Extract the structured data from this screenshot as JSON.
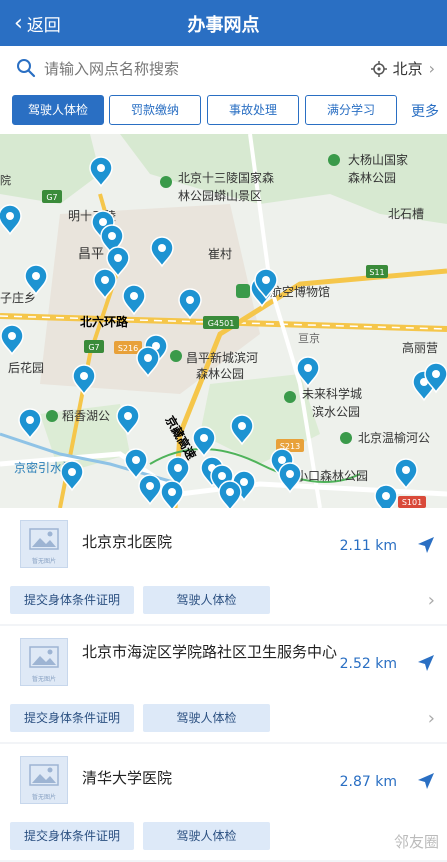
{
  "header": {
    "back_label": "返回",
    "title": "办事网点"
  },
  "search": {
    "placeholder": "请输入网点名称搜索",
    "city": "北京"
  },
  "tabs": [
    {
      "label": "驾驶人体检",
      "active": true
    },
    {
      "label": "罚款缴纳",
      "active": false
    },
    {
      "label": "事故处理",
      "active": false
    },
    {
      "label": "满分学习",
      "active": false
    }
  ],
  "more_label": "更多",
  "map": {
    "labels": {
      "ming13": "明十三陵",
      "shisanling_1": "北京十三陵国家森",
      "shisanling_2": "林公园蟒山景区",
      "dayang_1": "大杨山国家",
      "dayang_2": "森林公园",
      "beishijing": "北石槽",
      "changping": "昌平",
      "cuicun": "崔村",
      "aviation": "国航空博物馆",
      "ring6": "北六环路",
      "g4501": "G4501",
      "g7": "G7",
      "s216": "S216",
      "s11": "S11",
      "s213": "S213",
      "s101": "S101",
      "binhe_1": "昌平新城滨河",
      "binhe_2": "森林公园",
      "huiyuan": "亘京",
      "gaoliying": "高丽营",
      "future_1": "未来科学城",
      "future_2": "滨水公园",
      "houhua": "后花园",
      "daoxiang": "稻香湖公",
      "jingzang": "京藏高速",
      "wenyu": "北京温榆河公",
      "xiaokou": "小口森林公园",
      "jingmi": "京密引水渠",
      "zizhuang": "子庄乡",
      "yuan": "院"
    }
  },
  "list": [
    {
      "name": "北京京北医院",
      "distance": "2.11 km",
      "tags": [
        "提交身体条件证明",
        "驾驶人体检"
      ],
      "thumb_caption": "暂无图片"
    },
    {
      "name": "北京市海淀区学院路社区卫生服务中心",
      "distance": "2.52 km",
      "tags": [
        "提交身体条件证明",
        "驾驶人体检"
      ],
      "thumb_caption": "暂无图片"
    },
    {
      "name": "清华大学医院",
      "distance": "2.87 km",
      "tags": [
        "提交身体条件证明",
        "驾驶人体检"
      ],
      "thumb_caption": "暂无图片"
    }
  ],
  "watermark": "邻友圈",
  "colors": {
    "brand": "#2a6fc3",
    "pin": "#1d93d2",
    "tag_bg": "#dde9f8"
  }
}
